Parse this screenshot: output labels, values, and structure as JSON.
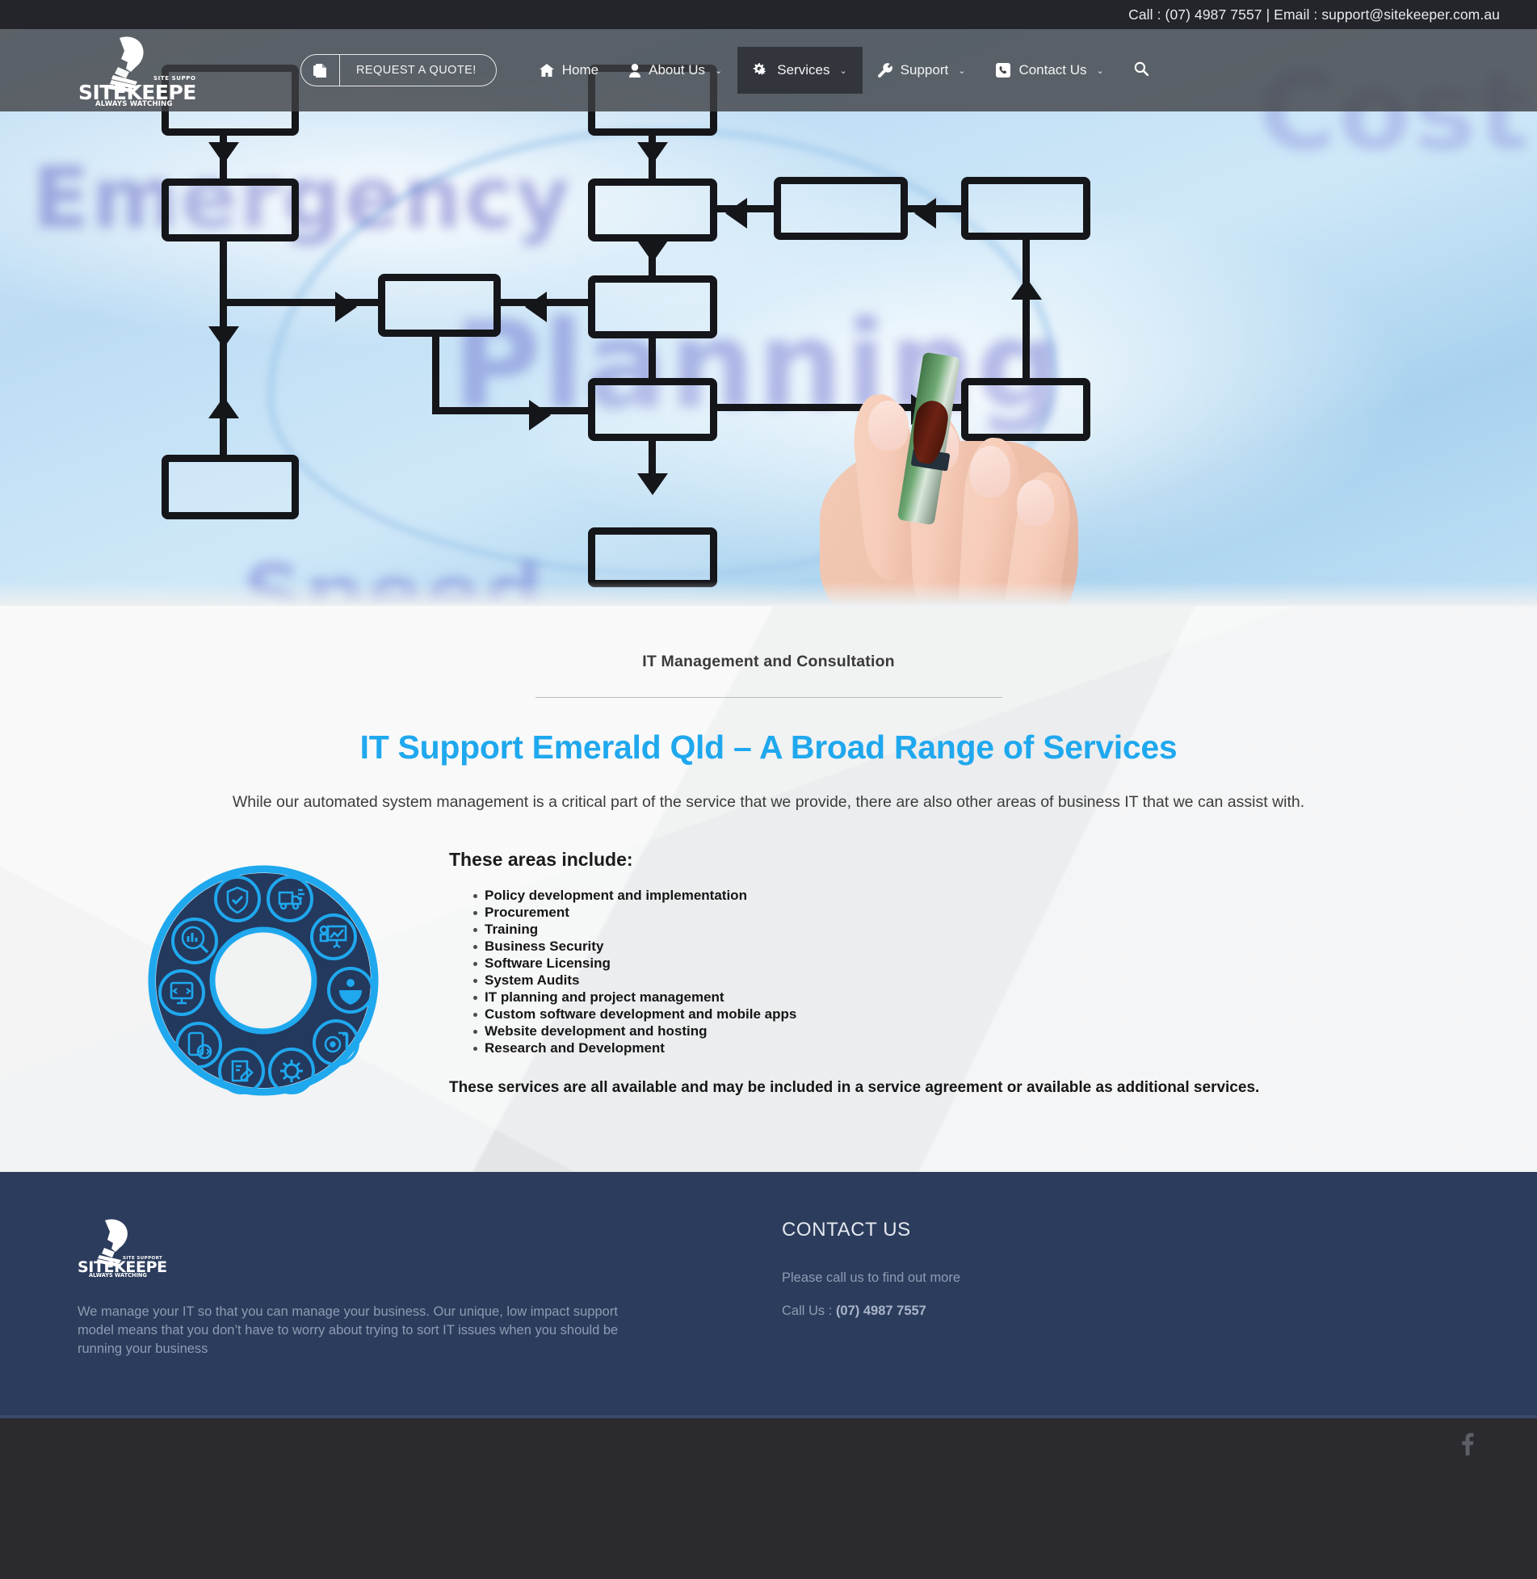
{
  "topbar": {
    "call_label": "Call : ",
    "phone": "(07) 4987 7557",
    "separator": "|",
    "email_label": "Email : ",
    "email": "support@sitekeeper.com.au",
    "full_text": "Call : (07) 4987 7557 | Email : support@sitekeeper.com.au"
  },
  "brand": {
    "name": "SITEKEEPER",
    "tagline": "ALWAYS WATCHING",
    "superscript": "SITE SUPPORT"
  },
  "header": {
    "quote_button": "REQUEST A QUOTE!",
    "quote_icon": "document-icon",
    "nav": [
      {
        "label": "Home",
        "icon": "home-icon",
        "caret": "",
        "active": false
      },
      {
        "label": "About Us",
        "icon": "user-icon",
        "caret": "⌄",
        "active": false
      },
      {
        "label": "Services",
        "icon": "gears-icon",
        "caret": "⌄",
        "active": true
      },
      {
        "label": "Support",
        "icon": "wrench-icon",
        "caret": "⌄",
        "active": false
      },
      {
        "label": "Contact Us",
        "icon": "phone-icon",
        "caret": "⌄",
        "active": false
      }
    ],
    "search_icon": "search-icon"
  },
  "hero": {
    "alt": "Hand drawing a business process flowchart on glass",
    "background_words": [
      "Emergency",
      "Planning",
      "Speed",
      "Cost"
    ]
  },
  "main": {
    "eyebrow": "IT Management and Consultation",
    "heading": "IT Support Emerald Qld – A Broad Range of Services",
    "lede": "While our automated system management is a critical part of the service that we provide, there are also other areas of business IT that we can assist with.",
    "areas_heading": "These areas include:",
    "areas": [
      "Policy development and implementation",
      "Procurement",
      "Training",
      "Business Security",
      "Software Licensing",
      "System Audits",
      "IT planning and project management",
      "Custom software development and mobile apps",
      "Website development and hosting",
      "Research and Development"
    ],
    "closing": "These services are all available and may be included in a service agreement or available as additional services.",
    "graphic": {
      "name": "services-ring-graphic",
      "ring_color": "#1fa8ee",
      "ring_fill": "#23395e",
      "icons": [
        "shield-check-icon",
        "delivery-truck-icon",
        "presentation-chart-icon",
        "people-group-icon",
        "media-library-icon",
        "gear-icon",
        "edit-document-icon",
        "mobile-code-icon",
        "monitor-code-icon",
        "analytics-search-icon"
      ]
    }
  },
  "footer": {
    "description": "We manage your IT so that you can manage your business. Our unique, low impact support model means that you don’t have to worry about trying to sort IT issues when you should be running your business",
    "contact_title": "CONTACT US",
    "contact_sub": "Please call us to find out more",
    "call_label": "Call Us : ",
    "call_number": "(07) 4987 7557",
    "social": [
      {
        "name": "facebook-icon",
        "glyph": "f"
      }
    ]
  },
  "colors": {
    "accent": "#1fa8ee",
    "footer_bg": "#2c3c5c",
    "topbar_bg": "#23252b",
    "bottombar_bg": "#2b2b2f",
    "heading_text": "#1fa8ee"
  }
}
